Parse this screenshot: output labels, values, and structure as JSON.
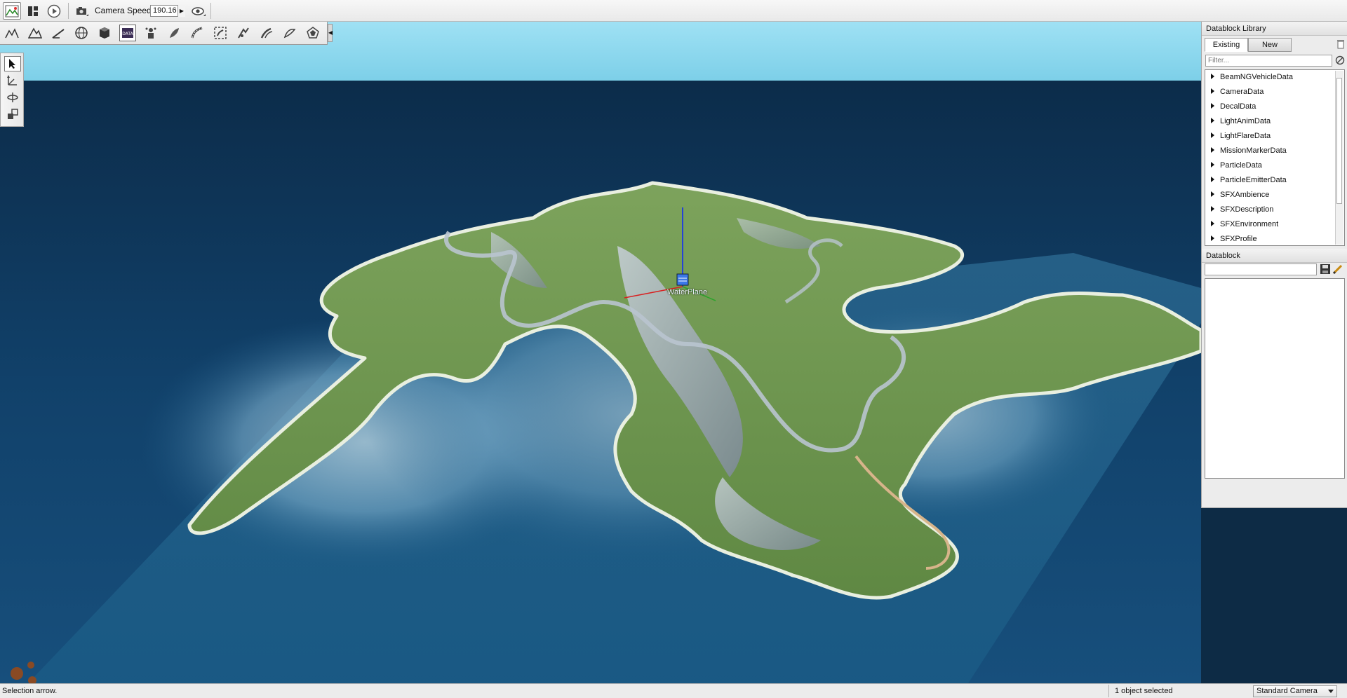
{
  "toolbar": {
    "camera_speed_label": "Camera Speed",
    "camera_speed_value": "190.16"
  },
  "viewport": {
    "selected_object_label": "WaterPlane"
  },
  "datablock_library": {
    "title": "Datablock Library",
    "tabs": [
      {
        "label": "Existing",
        "active": true
      },
      {
        "label": "New",
        "active": false
      }
    ],
    "filter_placeholder": "Filter...",
    "items": [
      {
        "label": "BeamNGVehicleData"
      },
      {
        "label": "CameraData"
      },
      {
        "label": "DecalData"
      },
      {
        "label": "LightAnimData"
      },
      {
        "label": "LightFlareData"
      },
      {
        "label": "MissionMarkerData"
      },
      {
        "label": "ParticleData"
      },
      {
        "label": "ParticleEmitterData"
      },
      {
        "label": "SFXAmbience"
      },
      {
        "label": "SFXDescription"
      },
      {
        "label": "SFXEnvironment"
      },
      {
        "label": "SFXProfile"
      }
    ]
  },
  "datablock": {
    "title": "Datablock",
    "name_value": ""
  },
  "status_bar": {
    "hint": "Selection arrow.",
    "selection": "1 object selected",
    "camera_mode": "Standard Camera"
  }
}
